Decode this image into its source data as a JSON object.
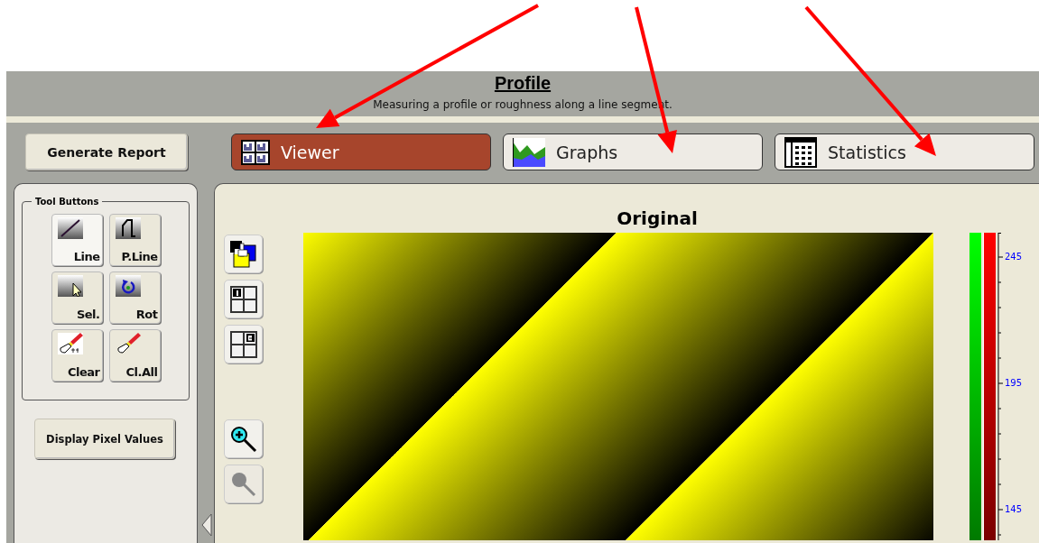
{
  "header": {
    "title": "Profile",
    "subtitle": "Measuring a profile or roughness along a line segment."
  },
  "report_button": "Generate Report",
  "tabs": [
    {
      "label": "Viewer",
      "kind": "viewer",
      "selected": true
    },
    {
      "label": "Graphs",
      "kind": "graphs",
      "selected": false
    },
    {
      "label": "Statistics",
      "kind": "statistics",
      "selected": false
    }
  ],
  "tool_group": {
    "title": "Tool Buttons",
    "tools": [
      {
        "label": "Line",
        "kind": "line",
        "selected": true
      },
      {
        "label": "P.Line",
        "kind": "polyline",
        "selected": false
      },
      {
        "label": "Sel.",
        "kind": "select",
        "selected": false
      },
      {
        "label": "Rot",
        "kind": "rotate",
        "selected": false
      },
      {
        "label": "Clear",
        "kind": "clear-sel",
        "selected": false
      },
      {
        "label": "Cl.All",
        "kind": "clear-all",
        "selected": false
      }
    ]
  },
  "pixel_button": "Display Pixel Values",
  "viewer": {
    "title": "Original",
    "side_buttons": [
      {
        "kind": "overlay",
        "disabled": false
      },
      {
        "kind": "view1",
        "disabled": false
      },
      {
        "kind": "view2",
        "disabled": false
      },
      {
        "kind": "zoom-in",
        "disabled": false
      },
      {
        "kind": "zoom-out",
        "disabled": true
      }
    ],
    "colorbar_labels": [
      "245",
      "195",
      "145"
    ]
  },
  "annotations": [
    {
      "kind": "arrow"
    },
    {
      "kind": "arrow"
    },
    {
      "kind": "arrow"
    }
  ]
}
